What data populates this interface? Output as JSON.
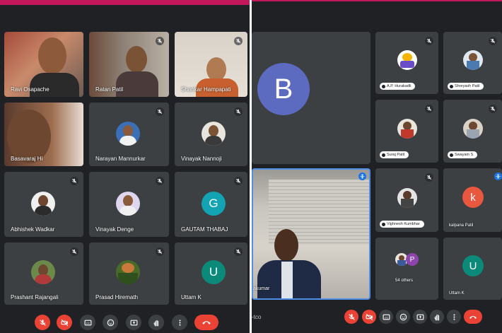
{
  "colors": {
    "accent_bar": "#c2185b",
    "end_call": "#ea4335",
    "blue": "#1a73e8"
  },
  "left": {
    "participants": [
      {
        "name": "Ravi Osapache",
        "kind": "video"
      },
      {
        "name": "Ratan Patil",
        "kind": "video"
      },
      {
        "name": "Shankar Hampapati",
        "kind": "video"
      },
      {
        "name": "Basavaraj Hi",
        "kind": "video"
      },
      {
        "name": "Narayan Mannurkar",
        "kind": "photo"
      },
      {
        "name": "Vinayak Nannoji",
        "kind": "photo"
      },
      {
        "name": "Abhishek Wadkar",
        "kind": "photo"
      },
      {
        "name": "Vinayak Denge",
        "kind": "photo"
      },
      {
        "name": "GAUTAM THABAJ",
        "kind": "letter",
        "letter": "G",
        "color": "#12a4b3"
      },
      {
        "name": "Prashant Rajangali",
        "kind": "photo"
      },
      {
        "name": "Prasad Hiremath",
        "kind": "photo"
      },
      {
        "name": "Uttam K",
        "kind": "letter",
        "letter": "U",
        "color": "#0b8a79"
      }
    ],
    "controls": [
      "mic-off-icon",
      "camera-off-icon",
      "captions-icon",
      "emoji-icon",
      "present-icon",
      "raise-hand-icon",
      "more-icon",
      "end-call-icon"
    ]
  },
  "right": {
    "presenter": {
      "letter": "B",
      "color": "#5c6bc0"
    },
    "pinned": {
      "name": "akumar"
    },
    "participants": [
      {
        "name": "A.P. Hurakadli",
        "kind": "photo"
      },
      {
        "name": "Shreyash Patil",
        "kind": "photo"
      },
      {
        "name": "Suraj Patil",
        "kind": "photo"
      },
      {
        "name": "Swayam S",
        "kind": "photo"
      },
      {
        "name": "Vighnesh Kumbhar",
        "kind": "photo"
      },
      {
        "name": "kalpana Patil",
        "kind": "letter",
        "letter": "k",
        "color": "#e8583f"
      },
      {
        "name": "54 others",
        "kind": "others",
        "letter": "P",
        "color": "#8e44ad"
      },
      {
        "name": "Uttam K",
        "kind": "letter",
        "letter": "U",
        "color": "#0b8a79"
      }
    ],
    "meeting_code_fragment": "-tco",
    "controls": [
      "mic-off-icon",
      "camera-off-icon",
      "captions-icon",
      "emoji-icon",
      "present-icon",
      "raise-hand-icon",
      "more-icon",
      "end-call-icon"
    ]
  }
}
